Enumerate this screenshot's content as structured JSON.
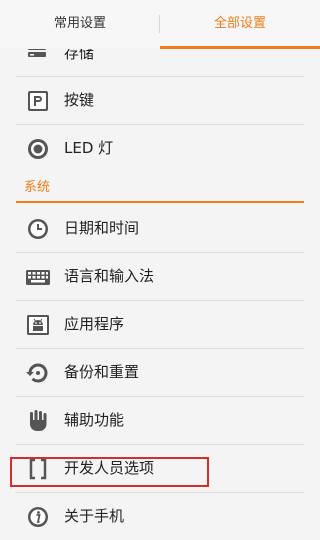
{
  "tabs": {
    "common": "常用设置",
    "all": "全部设置"
  },
  "top_items": [
    {
      "label": "存储",
      "icon": "storage-icon"
    },
    {
      "label": "按键",
      "icon": "button-key-icon"
    },
    {
      "label": "LED 灯",
      "icon": "led-icon"
    }
  ],
  "section": {
    "title": "系统"
  },
  "system_items": [
    {
      "label": "日期和时间",
      "icon": "clock-icon"
    },
    {
      "label": "语言和输入法",
      "icon": "keyboard-icon"
    },
    {
      "label": "应用程序",
      "icon": "android-icon"
    },
    {
      "label": "备份和重置",
      "icon": "backup-icon"
    },
    {
      "label": "辅助功能",
      "icon": "hand-icon"
    },
    {
      "label": "开发人员选项",
      "icon": "braces-icon"
    },
    {
      "label": "关于手机",
      "icon": "info-icon"
    }
  ],
  "colors": {
    "accent": "#ef7d1a",
    "highlight": "#d32d2d"
  }
}
